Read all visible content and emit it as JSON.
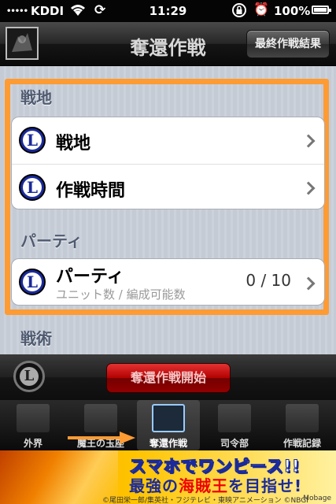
{
  "status_bar": {
    "carrier": "KDDI",
    "time": "11:29",
    "battery": "100%"
  },
  "nav": {
    "title": "奪還作戦",
    "right_button": "最終作戦結果"
  },
  "sections": [
    {
      "header": "戦地",
      "rows": [
        {
          "label": "戦地"
        },
        {
          "label": "作戦時間"
        }
      ]
    },
    {
      "header": "パーティ",
      "rows": [
        {
          "label": "パーティ",
          "sublabel": "ユニット数 / 編成可能数",
          "value": "0 / 10"
        }
      ]
    },
    {
      "header": "戦術"
    }
  ],
  "action_bar": {
    "start_button": "奪還作戦開始"
  },
  "tab_bar": {
    "tabs": [
      {
        "label": "外界"
      },
      {
        "label": "魔王の玉座"
      },
      {
        "label": "奪還作戦"
      },
      {
        "label": "司令部"
      },
      {
        "label": "作戦記録"
      }
    ],
    "active_index": 2
  },
  "ad": {
    "line1": "スマホでワンピース!!",
    "line2_a": "最強の",
    "line2_b": "海賊王",
    "line2_c": "を目指せ!",
    "copyright": "©尾田栄一郎/集英社・フジテレビ・東映アニメーション ©NBGI",
    "brand": "Mobage"
  },
  "colors": {
    "highlight": "#ff9b33",
    "section_header": "#4f5b71",
    "start_button": "#cc1111"
  }
}
